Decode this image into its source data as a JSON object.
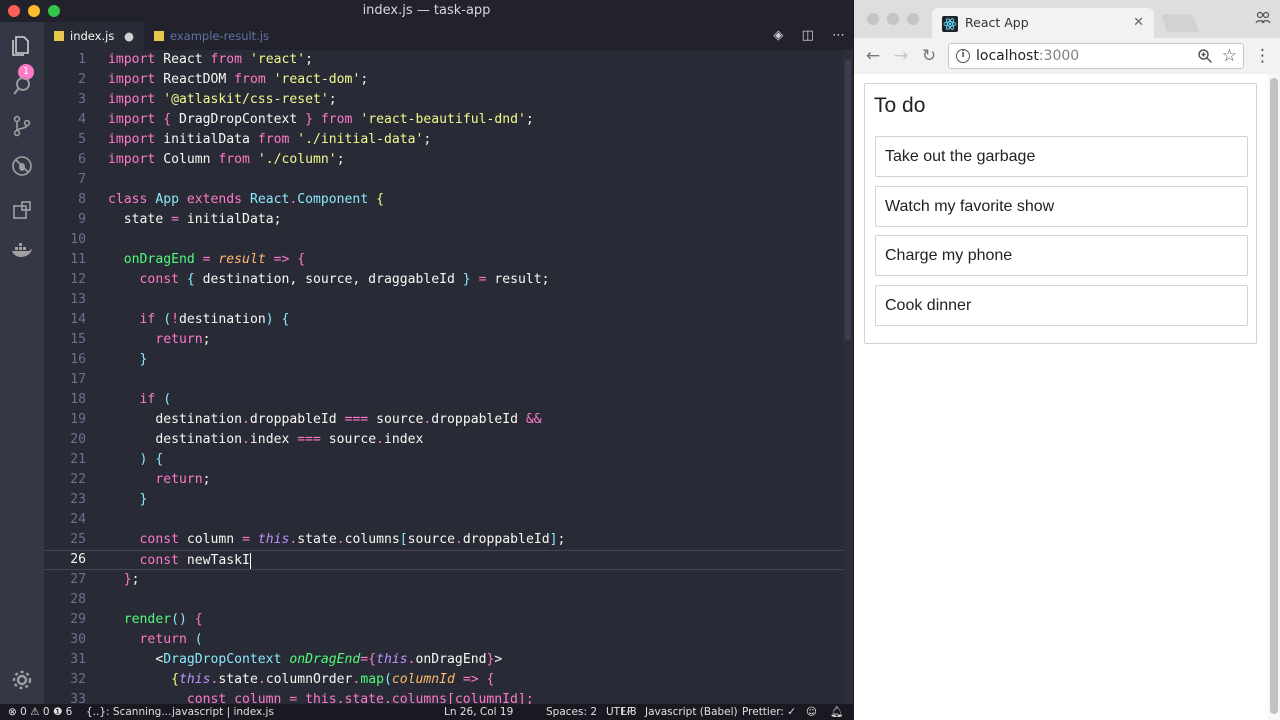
{
  "editor": {
    "window_title": "index.js — task-app",
    "activity_badge": "1",
    "tabs": [
      {
        "label": "index.js",
        "modified": true
      },
      {
        "label": "example-result.js",
        "modified": false
      }
    ],
    "line_numbers": [
      "1",
      "2",
      "3",
      "4",
      "5",
      "6",
      "7",
      "8",
      "9",
      "10",
      "11",
      "12",
      "13",
      "14",
      "15",
      "16",
      "17",
      "18",
      "19",
      "20",
      "21",
      "22",
      "23",
      "24",
      "25",
      "26",
      "27",
      "28",
      "29",
      "30",
      "31",
      "32",
      "33"
    ],
    "code": {
      "l1": [
        "import",
        "React",
        "from",
        "'react'",
        ";"
      ],
      "l2": [
        "import",
        "ReactDOM",
        "from",
        "'react-dom'",
        ";"
      ],
      "l3": [
        "import",
        "'@atlaskit/css-reset'",
        ";"
      ],
      "l4": [
        "import",
        "{",
        "DragDropContext",
        "}",
        "from",
        "'react-beautiful-dnd'",
        ";"
      ],
      "l5": [
        "import",
        "initialData",
        "from",
        "'./initial-data'",
        ";"
      ],
      "l6": [
        "import",
        "Column",
        "from",
        "'./column'",
        ";"
      ],
      "l8": [
        "class",
        "App",
        "extends",
        "React",
        ".",
        "Component",
        "{"
      ],
      "l9": [
        "state",
        "=",
        "initialData",
        ";"
      ],
      "l11": [
        "onDragEnd",
        "=",
        "result",
        "=>",
        "{"
      ],
      "l12": [
        "const",
        "{",
        "destination, source, draggableId",
        "}",
        "=",
        "result;"
      ],
      "l14": [
        "if",
        "(",
        "!",
        "destination",
        ")",
        "{"
      ],
      "l15": [
        "return",
        ";"
      ],
      "l16": [
        "}"
      ],
      "l18": [
        "if",
        "("
      ],
      "l19": [
        "destination",
        ".",
        "droppableId",
        "===",
        "source",
        ".",
        "droppableId",
        "&&"
      ],
      "l20": [
        "destination",
        ".",
        "index",
        "===",
        "source",
        ".",
        "index"
      ],
      "l21": [
        ")",
        "{"
      ],
      "l22": [
        "return",
        ";"
      ],
      "l23": [
        "}"
      ],
      "l25": [
        "const",
        "column",
        "=",
        "this",
        ".",
        "state",
        ".",
        "columns",
        "[",
        "source",
        ".",
        "droppableId",
        "]",
        ";"
      ],
      "l26": [
        "const",
        "newTaskI"
      ],
      "l27": [
        "}",
        ";"
      ],
      "l29": [
        "render",
        "()",
        "{"
      ],
      "l30": [
        "return",
        "("
      ],
      "l31": [
        "<",
        "DragDropContext",
        "onDragEnd",
        "={",
        "this",
        ".",
        "onDragEnd",
        "}",
        ">"
      ],
      "l32": [
        "{",
        "this",
        ".",
        "state",
        ".",
        "columnOrder",
        ".",
        "map",
        "(",
        "columnId",
        "=>",
        "{"
      ],
      "l33": [
        "const column = this.state.columns[columnId];"
      ]
    },
    "status": {
      "problems": "⊗ 0 ⚠ 0 ❶ 6",
      "scanning": "{..}: Scanning...",
      "branch": "javascript | index.js",
      "position": "Ln 26, Col 19",
      "spaces": "Spaces: 2",
      "encoding": "UTF-8",
      "eol": "LF",
      "language": "Javascript (Babel)",
      "prettier": "Prettier: ✓"
    }
  },
  "browser": {
    "tab_title": "React App",
    "url_host": "localhost",
    "url_port": ":3000",
    "column_title": "To do",
    "tasks": [
      "Take out the garbage",
      "Watch my favorite show",
      "Charge my phone",
      "Cook dinner"
    ]
  },
  "colors": {
    "editor_bg": "#282a36",
    "keyword": "#ff79c6",
    "string": "#f1fa8c",
    "class": "#8be9fd",
    "function": "#50fa7b",
    "param": "#ffb86c"
  }
}
